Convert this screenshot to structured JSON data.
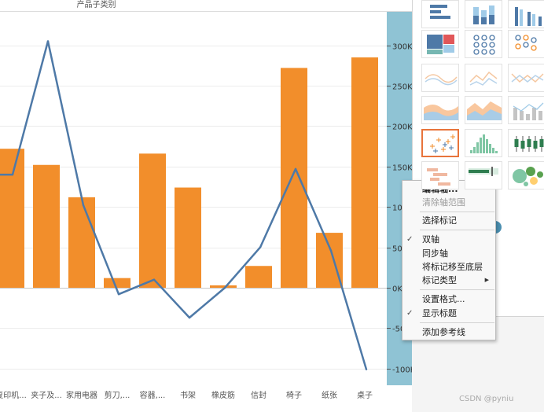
{
  "header": {
    "column_label": "产品子类别"
  },
  "chart_data": {
    "type": "bar",
    "categories": [
      "复印机...",
      "夹子及...",
      "家用电器",
      "剪刀,...",
      "容器,...",
      "书架",
      "橡皮筋",
      "信封",
      "椅子",
      "纸张",
      "桌子"
    ],
    "series": [
      {
        "type": "bar",
        "values": [
          172000,
          152000,
          112000,
          12000,
          166000,
          124000,
          3000,
          27000,
          272000,
          68000,
          285000
        ]
      },
      {
        "type": "line",
        "values": [
          140000,
          305000,
          102000,
          -8000,
          10000,
          -37000,
          0,
          50000,
          147000,
          46000,
          -101000
        ],
        "x_start": 0,
        "x_end": 10
      }
    ],
    "y_axis": {
      "ticks": [
        "300K",
        "250K",
        "200K",
        "150K",
        "100K",
        "50K",
        "0K",
        "-50K",
        "-100K"
      ],
      "range": [
        -110000,
        320000
      ]
    },
    "colors": {
      "bar": "#f28e2b",
      "line": "#4e79a7",
      "axis_band": "#8fc3d4"
    }
  },
  "marks_card": {
    "chart_types": [
      "text-table",
      "stacked-bar",
      "side-by-side-bars",
      "treemap",
      "circle-views",
      "side-by-side-circles",
      "lines-continuous",
      "lines-discrete",
      "dual-lines",
      "area-continuous",
      "area-discrete",
      "dual-combination",
      "scatter-plot",
      "histogram",
      "box-and-whisker",
      "gantt",
      "bullet-graph",
      "packed-bubbles"
    ],
    "selected": "scatter-plot"
  },
  "context_menu": {
    "items": [
      {
        "label": "编辑轴...",
        "bold": true,
        "disabled": false,
        "checked": false
      },
      {
        "label": "清除轴范围",
        "bold": false,
        "disabled": true,
        "checked": false
      },
      {
        "label": "选择标记",
        "bold": false,
        "disabled": false,
        "checked": false
      },
      {
        "label": "双轴",
        "bold": false,
        "disabled": false,
        "checked": true
      },
      {
        "label": "同步轴",
        "bold": false,
        "disabled": false,
        "checked": false
      },
      {
        "label": "将标记移至底层",
        "bold": false,
        "disabled": false,
        "checked": false
      },
      {
        "label": "标记类型",
        "bold": false,
        "disabled": false,
        "checked": false,
        "submenu": true
      },
      {
        "label": "设置格式...",
        "bold": false,
        "disabled": false,
        "checked": false
      },
      {
        "label": "显示标题",
        "bold": false,
        "disabled": false,
        "checked": true
      },
      {
        "label": "添加参考线",
        "bold": false,
        "disabled": false,
        "checked": false
      }
    ],
    "check_glyph": "✓",
    "submenu_glyph": "▶"
  },
  "watermark": "CSDN @pyniu"
}
